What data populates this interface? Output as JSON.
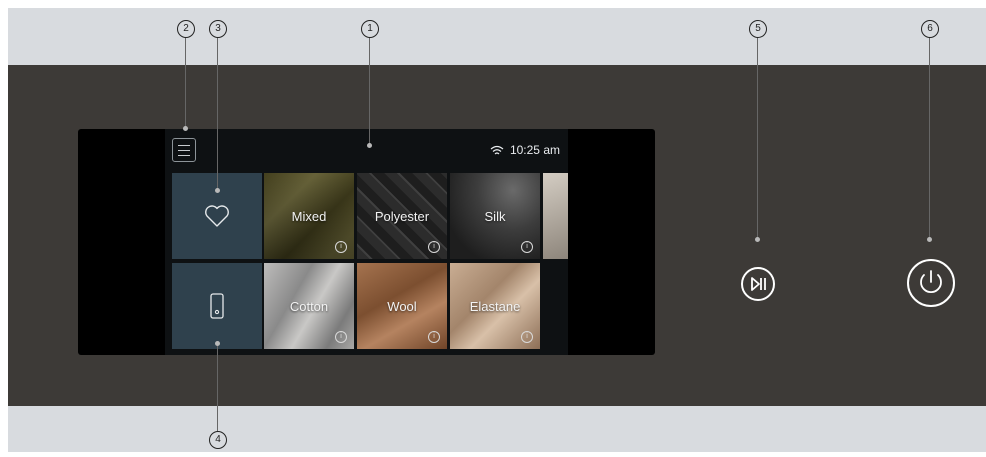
{
  "display": {
    "time": "10:25 am",
    "icons": {
      "menu": "hamburger-menu-icon",
      "wifi": "wifi-icon",
      "favorite": "heart-icon",
      "remote": "phone-remote-icon",
      "info": "info-icon"
    }
  },
  "programs": [
    {
      "label": "Mixed"
    },
    {
      "label": "Polyester"
    },
    {
      "label": "Silk"
    },
    {
      "label": "Cotton"
    },
    {
      "label": "Wool"
    },
    {
      "label": "Elastane"
    }
  ],
  "info_glyph": "i",
  "controls": {
    "start_pause": "play-pause-icon",
    "power": "power-icon"
  },
  "callouts": [
    "1",
    "2",
    "3",
    "4",
    "5",
    "6"
  ],
  "colors": {
    "panel": "#3d3a37",
    "accent_tile": "#2f414d",
    "background": "#d8dbdf"
  }
}
